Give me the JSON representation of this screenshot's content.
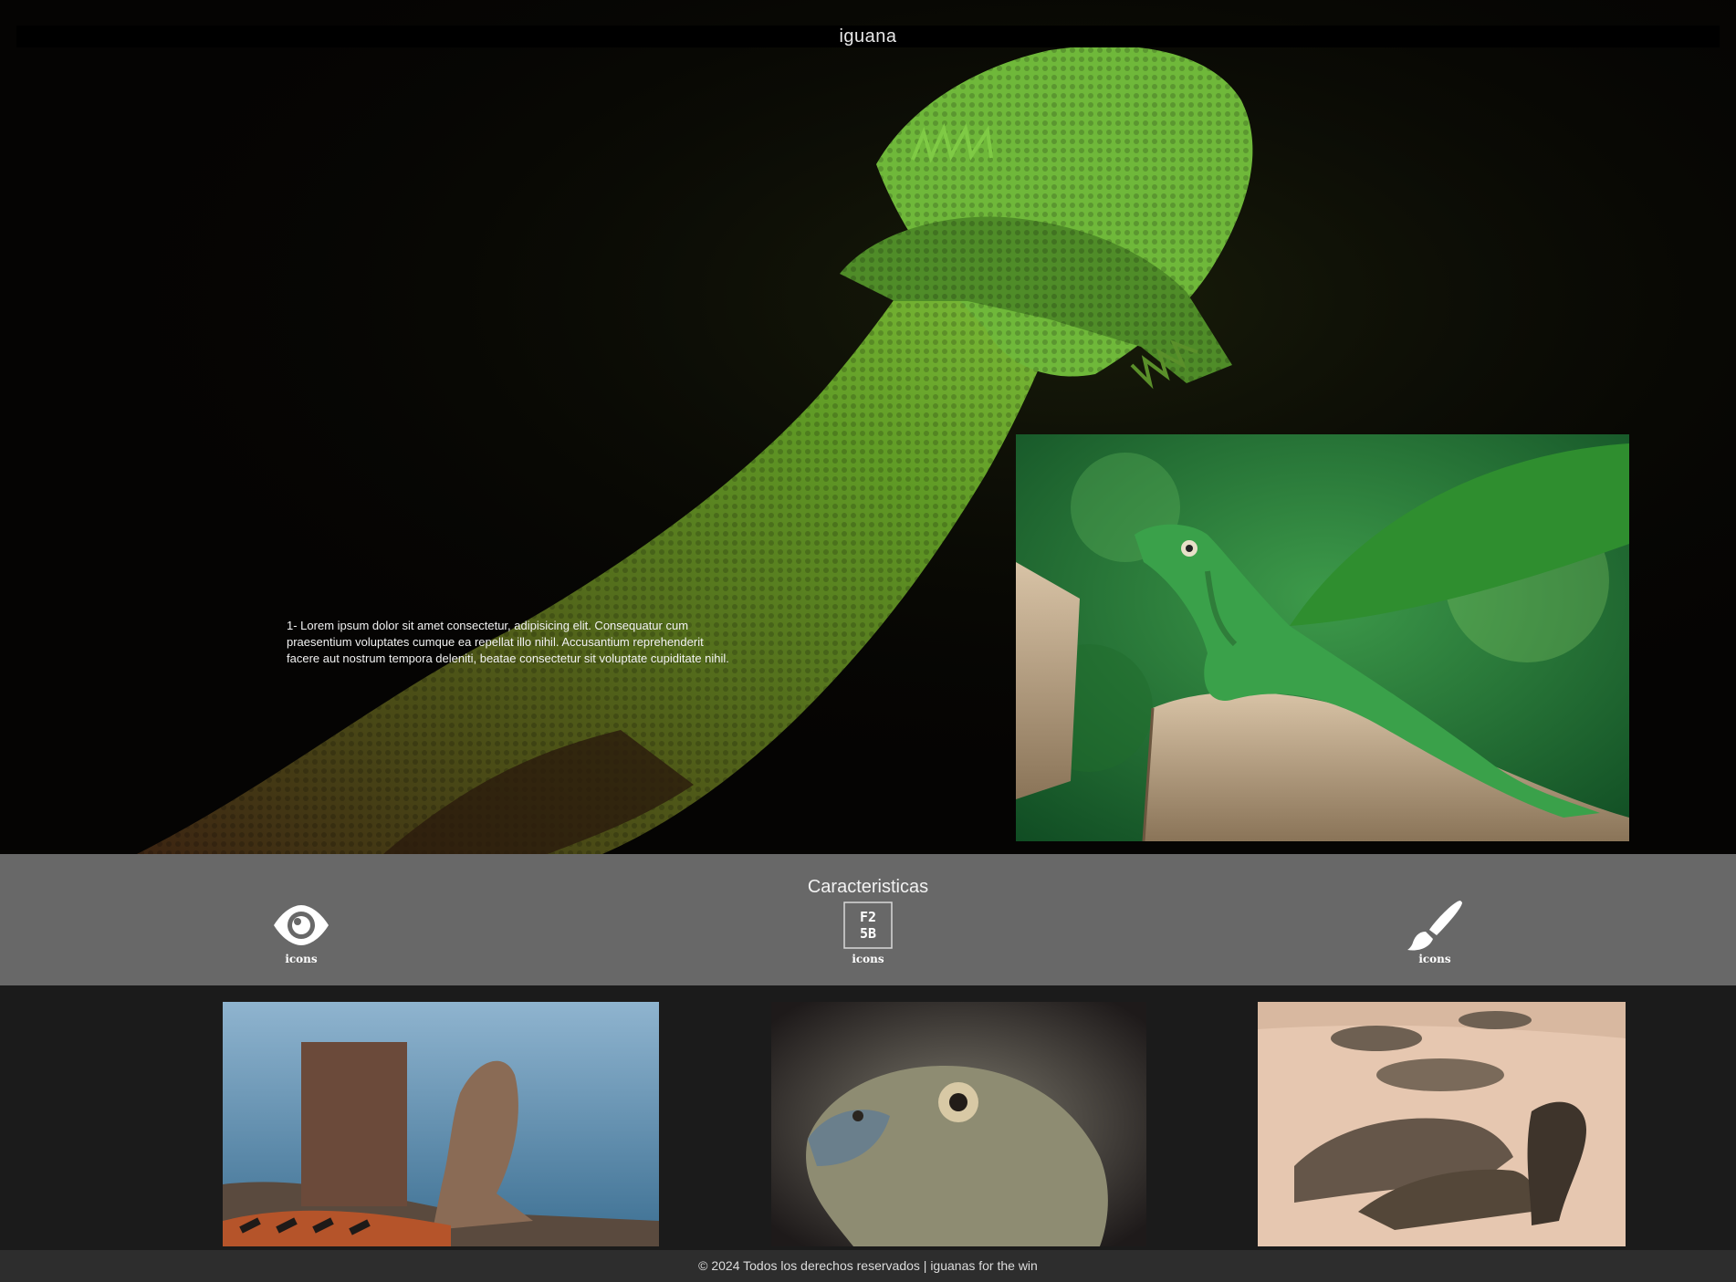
{
  "header": {
    "title": "iguana"
  },
  "hero": {
    "text": "1- Lorem ipsum dolor sit amet consectetur, adipisicing elit. Consequatur cum praesentium voluptates cumque ea repellat illo nihil. Accusantium reprehenderit facere aut nostrum tempora deleniti, beatae consectetur sit voluptate cupiditate nihil."
  },
  "features": {
    "title": "Caracteristicas",
    "items": [
      {
        "icon": "eye-icon",
        "label": "icons"
      },
      {
        "icon": "broken-image-icon",
        "label": "icons",
        "glyph": "F2\n5B"
      },
      {
        "icon": "paint-brush-icon",
        "label": "icons"
      }
    ]
  },
  "footer": {
    "text": "© 2024 Todos los derechos reservados | iguanas for the win"
  },
  "colors": {
    "hero_bg": "#050403",
    "features_bg": "#686868",
    "gallery_bg": "#1b1b1b",
    "footer_bg": "#2d2d2d",
    "iguana_green": "#6aa532"
  }
}
